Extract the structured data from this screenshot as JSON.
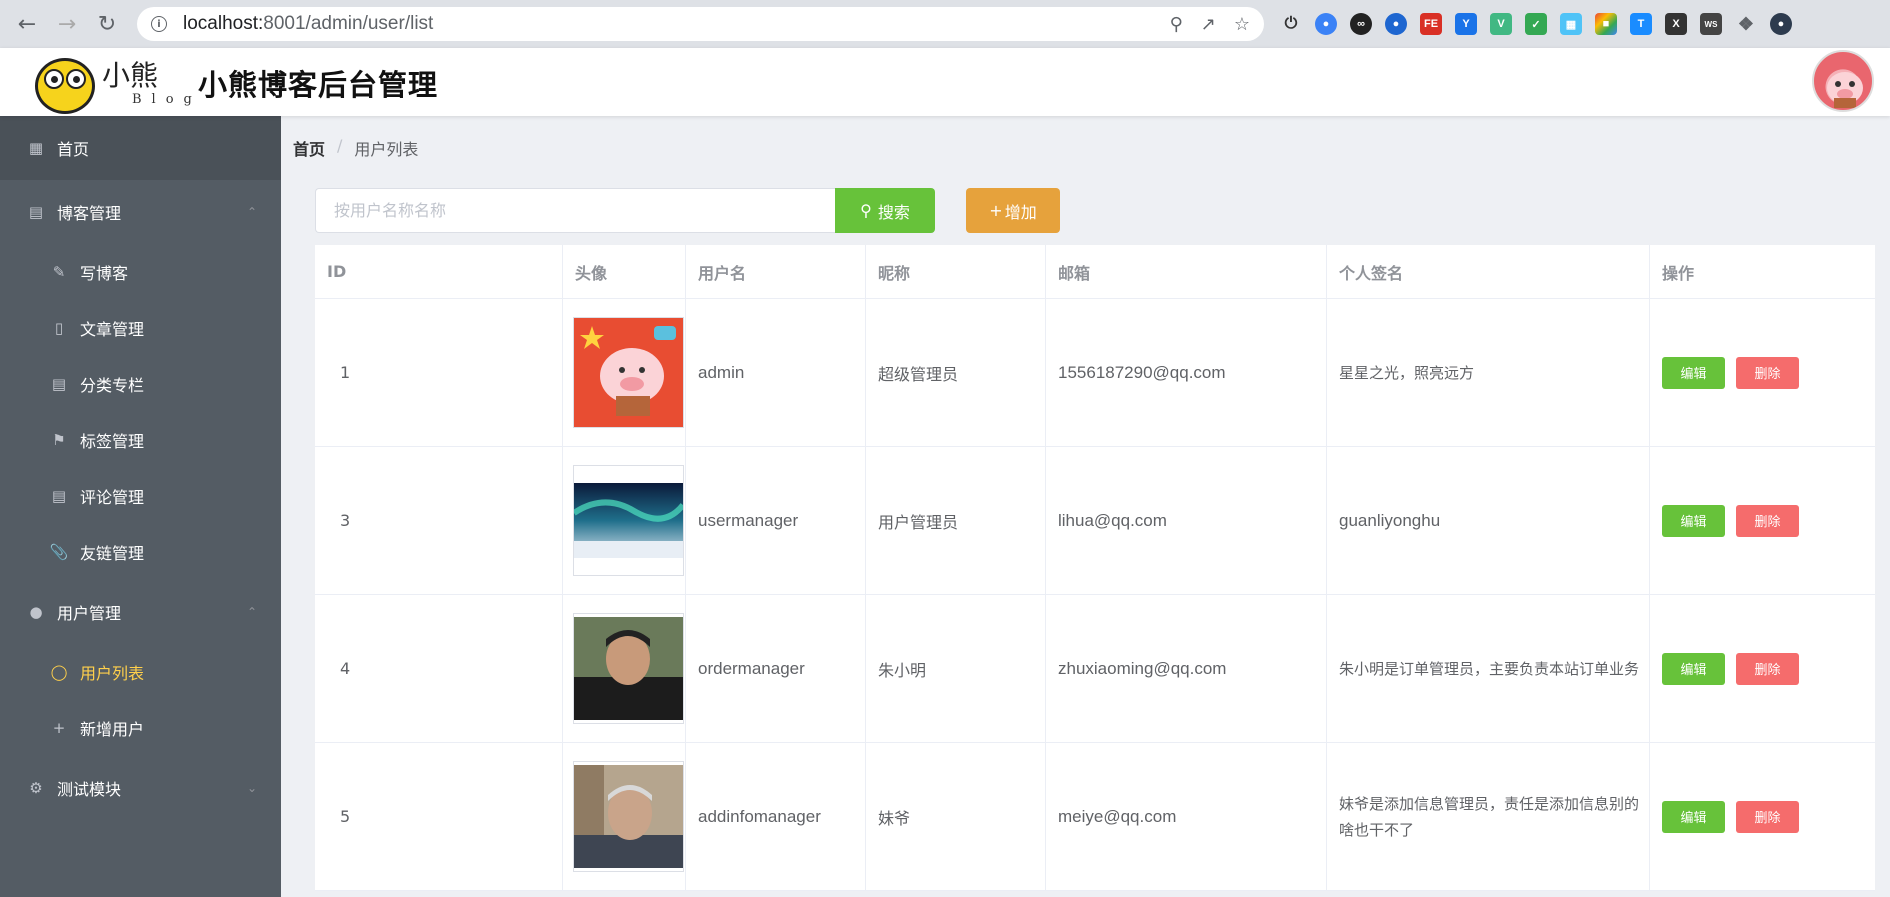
{
  "browser": {
    "url_host": "localhost:",
    "url_port_path": "8001/admin/user/list"
  },
  "header": {
    "logo_cn": "小熊",
    "logo_en": "Blog",
    "title": "小熊博客后台管理"
  },
  "sidebar": {
    "items": [
      {
        "label": "首页",
        "icon": "grid-icon"
      },
      {
        "label": "博客管理",
        "icon": "blog-icon"
      },
      {
        "label": "写博客",
        "icon": "pen-icon"
      },
      {
        "label": "文章管理",
        "icon": "notebook-icon"
      },
      {
        "label": "分类专栏",
        "icon": "document-icon"
      },
      {
        "label": "标签管理",
        "icon": "bookmark-icon"
      },
      {
        "label": "评论管理",
        "icon": "tickets-icon"
      },
      {
        "label": "友链管理",
        "icon": "paperclip-icon"
      },
      {
        "label": "用户管理",
        "icon": "user-icon"
      },
      {
        "label": "用户列表",
        "icon": "user-outline-icon"
      },
      {
        "label": "新增用户",
        "icon": "plus-icon"
      },
      {
        "label": "测试模块",
        "icon": "setting-icon"
      }
    ]
  },
  "breadcrumb": {
    "home": "首页",
    "separator": "/",
    "current": "用户列表"
  },
  "toolbar": {
    "search_placeholder": "按用户名称名称",
    "search_label": "搜索",
    "add_label": "增加"
  },
  "table": {
    "headers": [
      "ID",
      "头像",
      "用户名",
      "昵称",
      "邮箱",
      "个人签名",
      "操作"
    ],
    "rows": [
      {
        "id": "1",
        "username": "admin",
        "nickname": "超级管理员",
        "email": "1556187290@qq.com",
        "signature": "星星之光，照亮远方"
      },
      {
        "id": "3",
        "username": "usermanager",
        "nickname": "用户管理员",
        "email": "lihua@qq.com",
        "signature": "guanliyonghu"
      },
      {
        "id": "4",
        "username": "ordermanager",
        "nickname": "朱小明",
        "email": "zhuxiaoming@qq.com",
        "signature": "朱小明是订单管理员，主要负责本站订单业务"
      },
      {
        "id": "5",
        "username": "addinfomanager",
        "nickname": "妹爷",
        "email": "meiye@qq.com",
        "signature": "妹爷是添加信息管理员，责任是添加信息别的啥也干不了"
      }
    ],
    "edit_label": "编辑",
    "delete_label": "删除"
  },
  "colors": {
    "sidebar_bg": "#545c64",
    "active": "#ffd04b",
    "success": "#67c23a",
    "warning": "#e6a23c",
    "danger": "#f56c6c"
  }
}
